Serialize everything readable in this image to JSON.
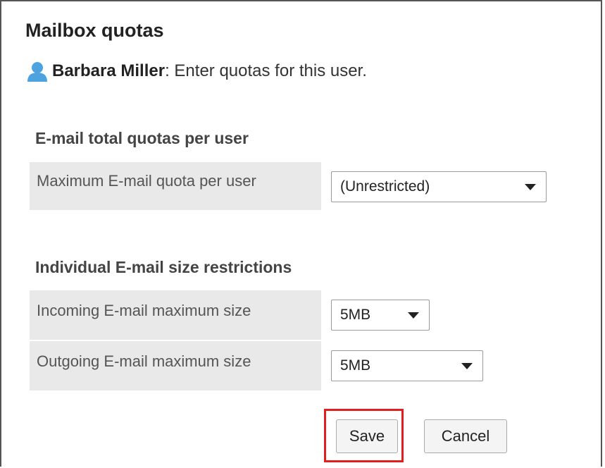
{
  "page": {
    "title": "Mailbox quotas",
    "user_name": "Barbara Miller",
    "user_suffix": ": Enter quotas for this user."
  },
  "sections": {
    "total": {
      "title": "E-mail total quotas per user",
      "max_label": "Maximum E-mail quota per user",
      "max_value": "(Unrestricted)"
    },
    "individual": {
      "title": "Individual E-mail size restrictions",
      "incoming_label": "Incoming E-mail maximum size",
      "incoming_value": "5MB",
      "outgoing_label": "Outgoing E-mail maximum size",
      "outgoing_value": "5MB"
    }
  },
  "buttons": {
    "save": "Save",
    "cancel": "Cancel"
  },
  "icons": {
    "user": "user-icon"
  },
  "colors": {
    "highlight": "#e02020",
    "user_icon": "#4da3e0",
    "label_bg": "#e9e9e9"
  }
}
